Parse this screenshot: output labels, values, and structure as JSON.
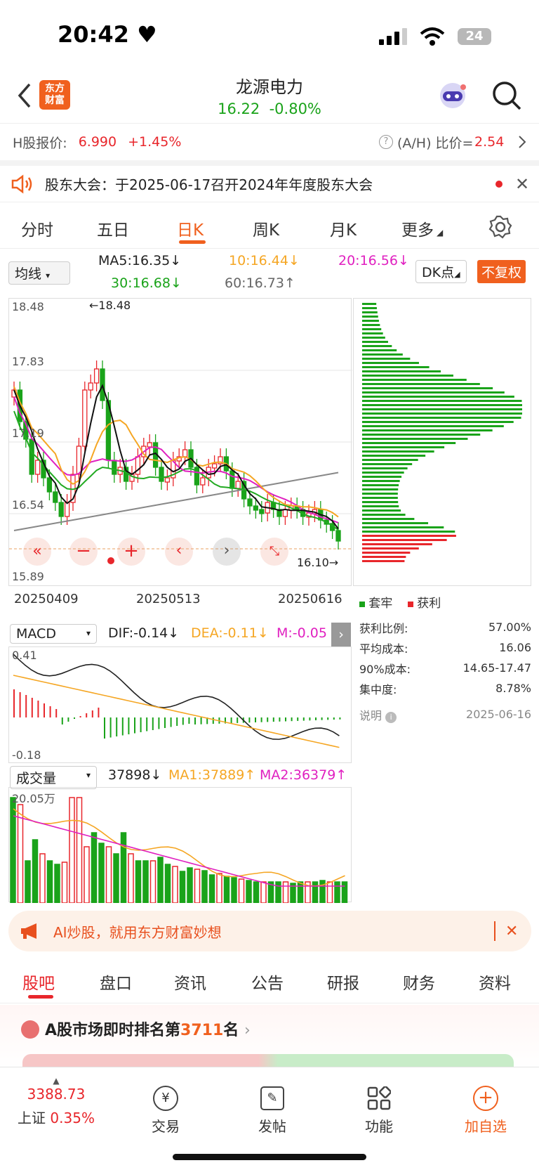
{
  "status": {
    "time": "20:42",
    "battery": "24"
  },
  "header": {
    "logo_line1": "东方",
    "logo_line2": "财富",
    "stock_name": "龙源电力",
    "price": "16.22",
    "change": "-0.80%"
  },
  "hshare": {
    "label": "H股报价:",
    "price": "6.990",
    "change": "+1.45%",
    "ah_label": "(A/H) 比价=",
    "ah_value": "2.54"
  },
  "notice": {
    "text": "股东大会：于2025-06-17召开2024年年度股东大会"
  },
  "ktabs": [
    "分时",
    "五日",
    "日K",
    "周K",
    "月K",
    "更多"
  ],
  "ktab_active": "日K",
  "ma": {
    "selector": "均线",
    "ma5": "MA5:16.35",
    "ma10": "10:16.44",
    "ma20": "20:16.56",
    "ma30": "30:16.68",
    "ma60": "60:16.73",
    "dk": "DK点",
    "fuquan": "不复权"
  },
  "kchart": {
    "y_labels": [
      "18.48",
      "17.83",
      "17.19",
      "16.54",
      "15.89"
    ],
    "high_marker": "←18.48",
    "last_marker": "16.10→",
    "x_labels": [
      "20250409",
      "20250513",
      "20250616"
    ]
  },
  "distribution": {
    "legend_hold": "套牢",
    "legend_profit": "获利",
    "stats": [
      {
        "label": "获利比例:",
        "value": "57.00%"
      },
      {
        "label": "平均成本:",
        "value": "16.06"
      },
      {
        "label": "90%成本:",
        "value": "14.65-17.47"
      },
      {
        "label": "集中度:",
        "value": "8.78%"
      }
    ],
    "note_label": "说明",
    "date": "2025-06-16"
  },
  "macd": {
    "selector": "MACD",
    "dif": "DIF:-0.14",
    "dea": "DEA:-0.11",
    "m": "M:-0.05",
    "top": "0.41",
    "bottom": "-0.18"
  },
  "volume": {
    "selector": "成交量",
    "value": "37898",
    "ma1": "MA1:37889",
    "ma2": "MA2:36379",
    "max_label": "20.05万"
  },
  "ai_banner": {
    "text": "AI炒股，就用东方财富妙想"
  },
  "btabs": [
    "股吧",
    "盘口",
    "资讯",
    "公告",
    "研报",
    "财务",
    "资料"
  ],
  "btab_active": "股吧",
  "rank": {
    "prefix": "A股市场即时排名第",
    "number": "3711",
    "suffix": "名"
  },
  "bottomnav": {
    "index_value": "3388.73",
    "index_name": "上证",
    "index_change": "0.35%",
    "trade": "交易",
    "post": "发帖",
    "func": "功能",
    "watch": "加自选"
  },
  "colors": {
    "up": "#e8262b",
    "down": "#1aa31a",
    "accent": "#f0601e"
  }
}
